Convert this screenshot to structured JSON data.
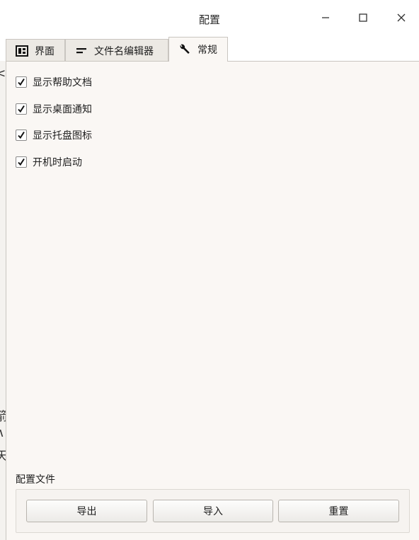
{
  "window": {
    "title": "配置"
  },
  "tabs": [
    {
      "label": "界面",
      "icon": "layout-icon",
      "active": false
    },
    {
      "label": "文件名编辑器",
      "icon": "text-lines-icon",
      "active": false
    },
    {
      "label": "常规",
      "icon": "wrench-icon",
      "active": true
    }
  ],
  "general": {
    "options": [
      {
        "label": "显示帮助文档",
        "checked": true
      },
      {
        "label": "显示桌面通知",
        "checked": true
      },
      {
        "label": "显示托盘图标",
        "checked": true
      },
      {
        "label": "开机时启动",
        "checked": true
      }
    ],
    "config_file_label": "配置文件",
    "buttons": {
      "export": "导出",
      "import": "导入",
      "reset": "重置"
    }
  },
  "background_window": {
    "partial_glyphs": [
      "<",
      "箭",
      "∧",
      "天"
    ]
  }
}
